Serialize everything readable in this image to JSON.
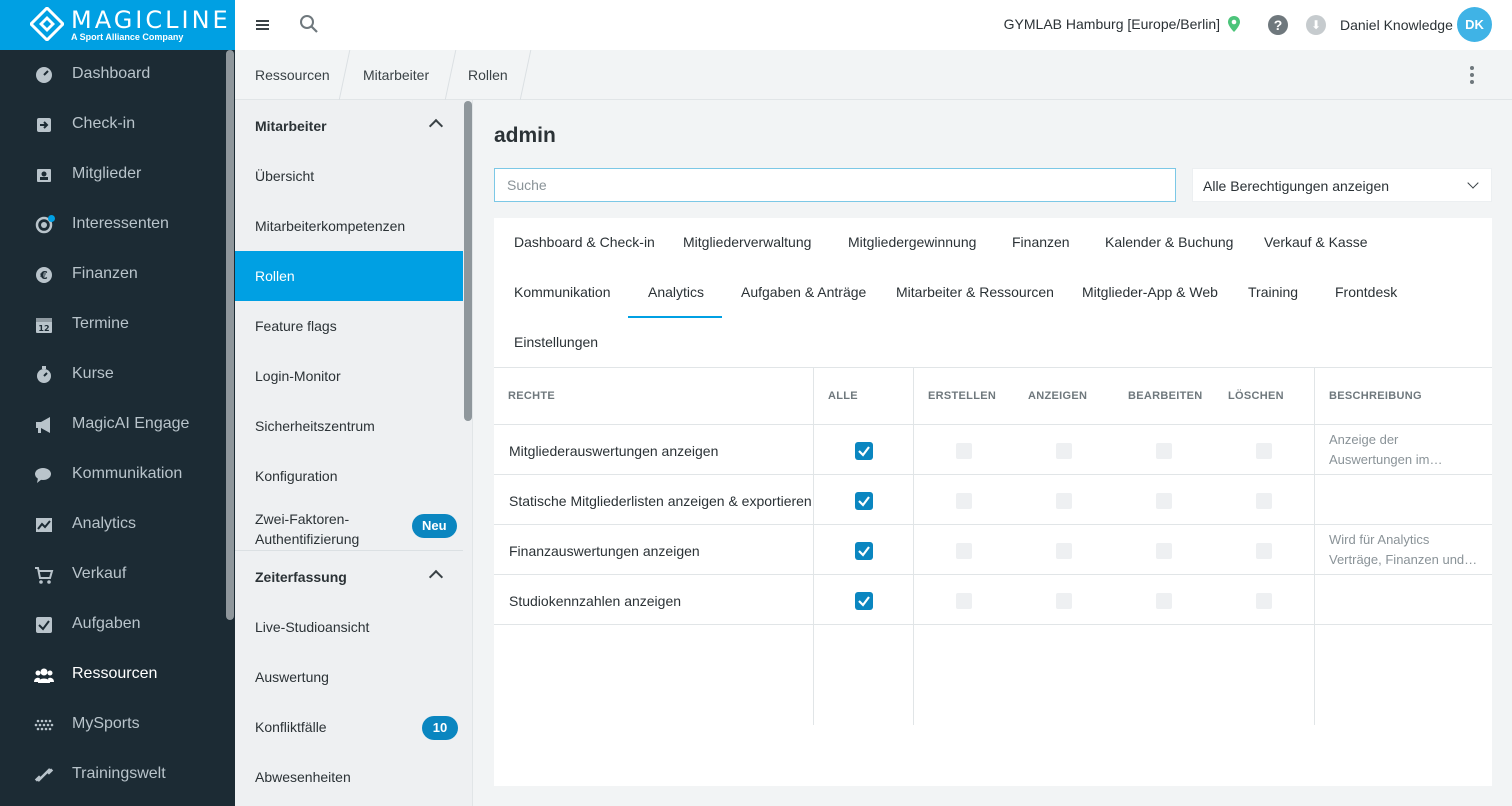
{
  "brand": {
    "name": "MAGICLINE",
    "tagline": "A Sport Alliance Company"
  },
  "nav": {
    "items": [
      {
        "label": "Dashboard",
        "icon": "dashboard-icon"
      },
      {
        "label": "Check-in",
        "icon": "check-in-icon"
      },
      {
        "label": "Mitglieder",
        "icon": "members-icon"
      },
      {
        "label": "Interessenten",
        "icon": "leads-icon"
      },
      {
        "label": "Finanzen",
        "icon": "euro-icon"
      },
      {
        "label": "Termine",
        "icon": "calendar-icon"
      },
      {
        "label": "Kurse",
        "icon": "stopwatch-icon"
      },
      {
        "label": "MagicAI Engage",
        "icon": "megaphone-icon"
      },
      {
        "label": "Kommunikation",
        "icon": "chat-icon"
      },
      {
        "label": "Analytics",
        "icon": "chart-icon"
      },
      {
        "label": "Verkauf",
        "icon": "cart-icon"
      },
      {
        "label": "Aufgaben",
        "icon": "checkbox-icon"
      },
      {
        "label": "Ressourcen",
        "icon": "people-icon"
      },
      {
        "label": "MySports",
        "icon": "dots-grid-icon"
      },
      {
        "label": "Trainingswelt",
        "icon": "dumbbell-icon"
      }
    ]
  },
  "topbar": {
    "studio": "GYMLAB Hamburg [Europe/Berlin]",
    "help": "?",
    "user": "Daniel Knowledge",
    "avatar": "DK"
  },
  "breadcrumb": [
    "Ressourcen",
    "Mitarbeiter",
    "Rollen"
  ],
  "submenu": {
    "section1": "Mitarbeiter",
    "items1": [
      "Übersicht",
      "Mitarbeiterkompetenzen",
      "Rollen",
      "Feature flags",
      "Login-Monitor",
      "Sicherheitszentrum",
      "Konfiguration"
    ],
    "twofa_line1": "Zwei-Faktoren-",
    "twofa_line2": "Authentifizierung",
    "new_badge": "Neu",
    "section2": "Zeiterfassung",
    "items2": [
      "Live-Studioansicht",
      "Auswertung",
      "Konfliktfälle",
      "Abwesenheiten"
    ],
    "conflict_count": "10"
  },
  "main": {
    "title": "admin",
    "search_placeholder": "Suche",
    "filter_value": "Alle Berechtigungen anzeigen",
    "tabs": [
      "Dashboard & Check-in",
      "Mitgliederverwaltung",
      "Mitgliedergewinnung",
      "Finanzen",
      "Kalender & Buchung",
      "Verkauf & Kasse",
      "Kommunikation",
      "Analytics",
      "Aufgaben & Anträge",
      "Mitarbeiter & Ressourcen",
      "Mitglieder-App & Web",
      "Training",
      "Frontdesk",
      "Einstellungen"
    ],
    "active_tab": "Analytics",
    "columns": [
      "RECHTE",
      "ALLE",
      "ERSTELLEN",
      "ANZEIGEN",
      "BEARBEITEN",
      "LÖSCHEN",
      "BESCHREIBUNG"
    ],
    "rows": [
      {
        "label": "Mitgliederauswertungen anzeigen",
        "all": true,
        "desc1": "Anzeige der",
        "desc2": "Auswertungen im…"
      },
      {
        "label": "Statische Mitgliederlisten anzeigen & exportieren",
        "all": true,
        "desc1": "",
        "desc2": ""
      },
      {
        "label": "Finanzauswertungen anzeigen",
        "all": true,
        "desc1": "Wird für Analytics",
        "desc2": "Verträge, Finanzen und…"
      },
      {
        "label": "Studiokennzahlen anzeigen",
        "all": true,
        "desc1": "",
        "desc2": ""
      }
    ]
  },
  "colors": {
    "primary": "#00a0e3",
    "sidebar": "#1c2b34",
    "checkbox": "#0a86c0"
  }
}
